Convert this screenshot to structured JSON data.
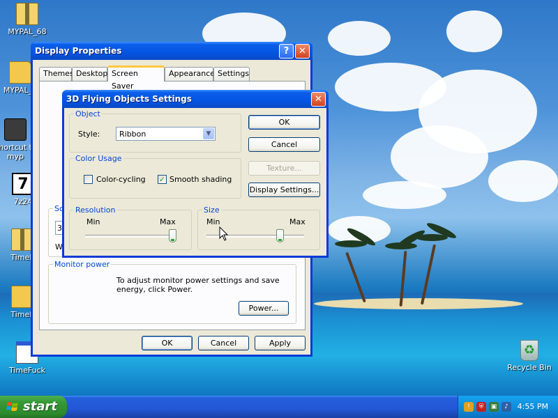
{
  "desktop": {
    "icons": [
      {
        "label": "MYPAL_68",
        "icon": "zip-folder-icon"
      },
      {
        "label": "MYPAL_6",
        "icon": "folder-icon"
      },
      {
        "label": "Shortcut to myp",
        "icon": "shortcut-icon"
      },
      {
        "label": "7z24",
        "icon": "seven-zip-icon"
      },
      {
        "label": "TimeF",
        "icon": "zip-folder-icon"
      },
      {
        "label": "TimeF",
        "icon": "folder-icon"
      },
      {
        "label": "TimeFuck",
        "icon": "document-icon"
      },
      {
        "label": "Recycle Bin",
        "icon": "recycle-bin-icon"
      }
    ]
  },
  "display_properties": {
    "title": "Display Properties",
    "tabs": [
      "Themes",
      "Desktop",
      "Screen Saver",
      "Appearance",
      "Settings"
    ],
    "active_tab": "Screen Saver",
    "screensaver_group_label": "Sc",
    "screensaver_value": "3D",
    "wait_label": "W",
    "monitor_power": {
      "legend": "Monitor power",
      "text": "To adjust monitor power settings and save energy, click Power.",
      "power_button": "Power..."
    },
    "buttons": {
      "ok": "OK",
      "cancel": "Cancel",
      "apply": "Apply"
    }
  },
  "flying_objects": {
    "title": "3D Flying Objects Settings",
    "object": {
      "legend": "Object",
      "style_label": "Style:",
      "style_value": "Ribbon"
    },
    "color_usage": {
      "legend": "Color Usage",
      "color_cycling": {
        "label": "Color-cycling",
        "checked": false
      },
      "smooth_shading": {
        "label": "Smooth shading",
        "checked": true
      }
    },
    "resolution": {
      "legend": "Resolution",
      "min": "Min",
      "max": "Max",
      "level": 1.0
    },
    "size": {
      "legend": "Size",
      "min": "Min",
      "max": "Max",
      "level": 0.75
    },
    "buttons": {
      "ok": "OK",
      "cancel": "Cancel",
      "texture": "Texture...",
      "display_settings": "Display Settings..."
    }
  },
  "taskbar": {
    "start_label": "start",
    "clock": "4:55 PM",
    "tray_icons": [
      "security-alert-icon",
      "shield-icon",
      "network-icon",
      "volume-icon"
    ]
  },
  "colors": {
    "title_blue": "#0454e2",
    "start_green": "#369936",
    "dialog_face": "#ece9d8",
    "group_legend": "#0046d5"
  }
}
